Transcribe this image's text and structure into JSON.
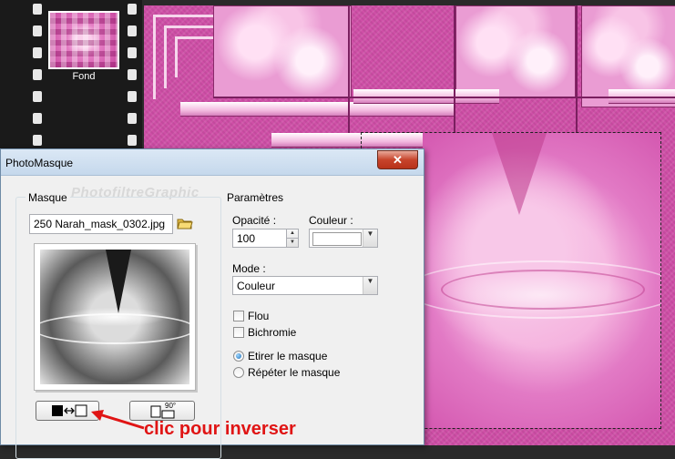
{
  "filmstrip": {
    "thumbnail_label": "Fond"
  },
  "dialog": {
    "title": "PhotoMasque",
    "close_label": "✕",
    "watermark": "PhotofiltreGraphic",
    "mask_group": {
      "label": "Masque",
      "filename": "250 Narah_mask_0302.jpg",
      "invert_icon": "invert-mask-icon",
      "rotate_label": "90°"
    },
    "params_group": {
      "label": "Paramètres",
      "opacity_label": "Opacité :",
      "opacity_value": "100",
      "color_label": "Couleur :",
      "color_value": "#ffffff",
      "mode_label": "Mode :",
      "mode_value": "Couleur",
      "blur_label": "Flou",
      "blur_checked": false,
      "bichromie_label": "Bichromie",
      "bichromie_checked": false,
      "stretch_label": "Etirer le masque",
      "repeat_label": "Répéter le masque",
      "selected_fit": "stretch"
    }
  },
  "annotation": {
    "text": "clic pour inverser",
    "color": "#e01414"
  }
}
